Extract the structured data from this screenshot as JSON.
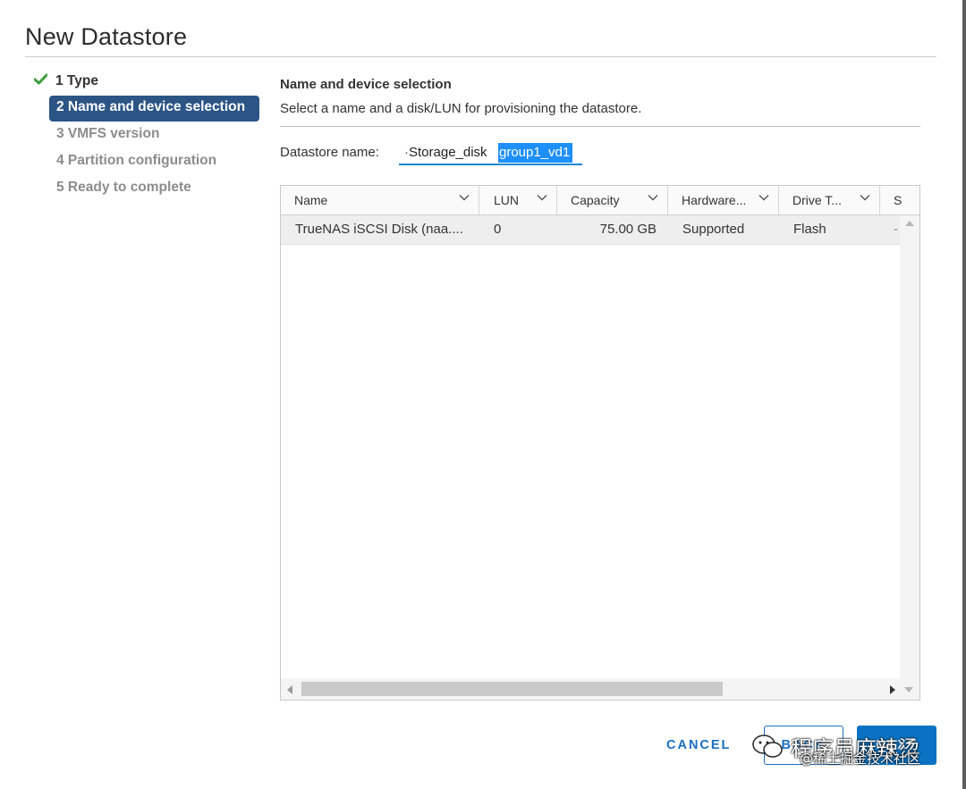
{
  "dialog": {
    "title": "New Datastore"
  },
  "steps": [
    {
      "label": "1 Type",
      "state": "done",
      "icon": "check-icon"
    },
    {
      "label": "2 Name and device selection",
      "state": "active"
    },
    {
      "label": "3 VMFS version",
      "state": "pending"
    },
    {
      "label": "4 Partition configuration",
      "state": "pending"
    },
    {
      "label": "5 Ready to complete",
      "state": "pending"
    }
  ],
  "content": {
    "title": "Name and device selection",
    "description": "Select a name and a disk/LUN for provisioning the datastore."
  },
  "datastore_name": {
    "label": "Datastore name:",
    "value": "Storage_diskgroup1_vd1",
    "visible_prefix": "Storage_disk",
    "selected_text": "group1_vd1"
  },
  "grid": {
    "columns": [
      "Name",
      "LUN",
      "Capacity",
      "Hardware...",
      "Drive T...",
      "S"
    ],
    "rows": [
      {
        "name": "TrueNAS iSCSI Disk (naa....",
        "lun": "0",
        "capacity": "75.00 GB",
        "hardware": "Supported",
        "drive_type": "Flash",
        "s": "-"
      }
    ]
  },
  "footer": {
    "cancel_label": "CANCEL",
    "back_label": "BACK",
    "next_label": "NEXT"
  },
  "watermark": {
    "line1": "程序员麻辣烫",
    "line2": "@稀土掘金技术社区"
  },
  "colors": {
    "accent": "#0a72c2",
    "active_step": "#2c5585",
    "selection": "#1e8ffe",
    "check": "#3b9d3b"
  }
}
